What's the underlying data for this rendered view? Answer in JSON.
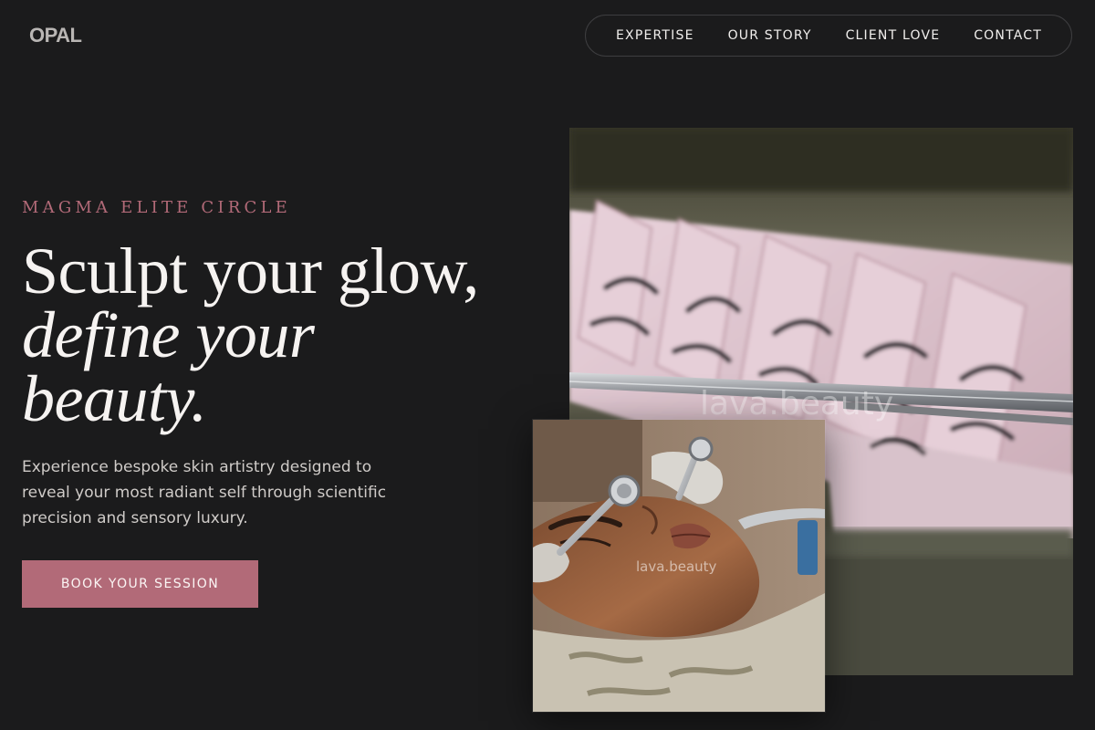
{
  "brand": {
    "logo": "OPAL"
  },
  "nav": {
    "items": [
      {
        "label": "EXPERTISE"
      },
      {
        "label": "OUR STORY"
      },
      {
        "label": "CLIENT LOVE"
      },
      {
        "label": "CONTACT"
      }
    ]
  },
  "hero": {
    "eyebrow": "MAGMA ELITE CIRCLE",
    "headline_line1": "Sculpt your glow,",
    "headline_line2": "define your",
    "headline_line3": "beauty.",
    "description": "Experience bespoke skin artistry designed to reveal your most radiant self through scientific precision and sensory luxury.",
    "cta_label": "BOOK YOUR SESSION"
  },
  "images": {
    "large_watermark": "lava.beauty",
    "small_watermark": "lava.beauty"
  },
  "colors": {
    "background": "#1b1b1c",
    "accent": "#b26a78",
    "text": "#f6f3f1"
  }
}
